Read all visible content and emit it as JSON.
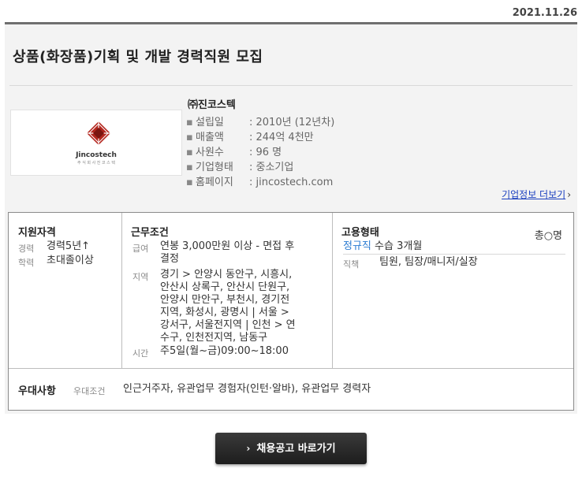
{
  "date": "2021.11.26",
  "title": "상품(화장품)기획 및 개발 경력직원 모집",
  "company": {
    "name": "㈜진코스텍",
    "logo_text": "Jincostech",
    "logo_subtext": "주 식 회 사 진 코 스 텍",
    "info": [
      {
        "key": "설립일",
        "value": ": 2010년 (12년차)"
      },
      {
        "key": "매출액",
        "value": ": 244억 4천만"
      },
      {
        "key": "사원수",
        "value": ": 96 명"
      },
      {
        "key": "기업형태",
        "value": ": 중소기업"
      },
      {
        "key": "홈페이지",
        "value": ": jincostech.com"
      }
    ],
    "more_link": "기업정보 더보기"
  },
  "qualification": {
    "heading": "지원자격",
    "career_label": "경력",
    "career_value": "경력5년↑",
    "education_label": "학력",
    "education_value": "초대졸이상"
  },
  "conditions": {
    "heading": "근무조건",
    "salary_label": "급여",
    "salary_lines": [
      "연봉 3,000만원 이상 - 면접 후",
      "결정"
    ],
    "region_label": "지역",
    "region_lines": [
      "경기 > 안양시 동안구, 시흥시,",
      "안산시 상록구, 안산시 단원구,",
      "안양시 만안구, 부천시, 경기전",
      "지역, 화성시, 광명시 | 서울 >",
      "강서구, 서울전지역 | 인천 > 연",
      "수구, 인천전지역, 남동구"
    ],
    "time_label": "시간",
    "time_value": "주5일(월~금)09:00~18:00"
  },
  "employment": {
    "heading": "고용형태",
    "count": "총○명",
    "type_value": "정규직",
    "type_extra": "수습 3개월",
    "position_label": "직책",
    "position_value": "팀원, 팀장/매니저/실장"
  },
  "preference": {
    "heading": "우대사항",
    "label": "우대조건",
    "value": "인근거주자, 유관업무 경험자(인턴·알바), 유관업무 경력자"
  },
  "apply_button": "채용공고 바로가기",
  "colors": {
    "link": "#1a3fbf",
    "accent_blue": "#2a7bd2",
    "button_bg": "#262626",
    "logo_red": "#b3261e"
  }
}
